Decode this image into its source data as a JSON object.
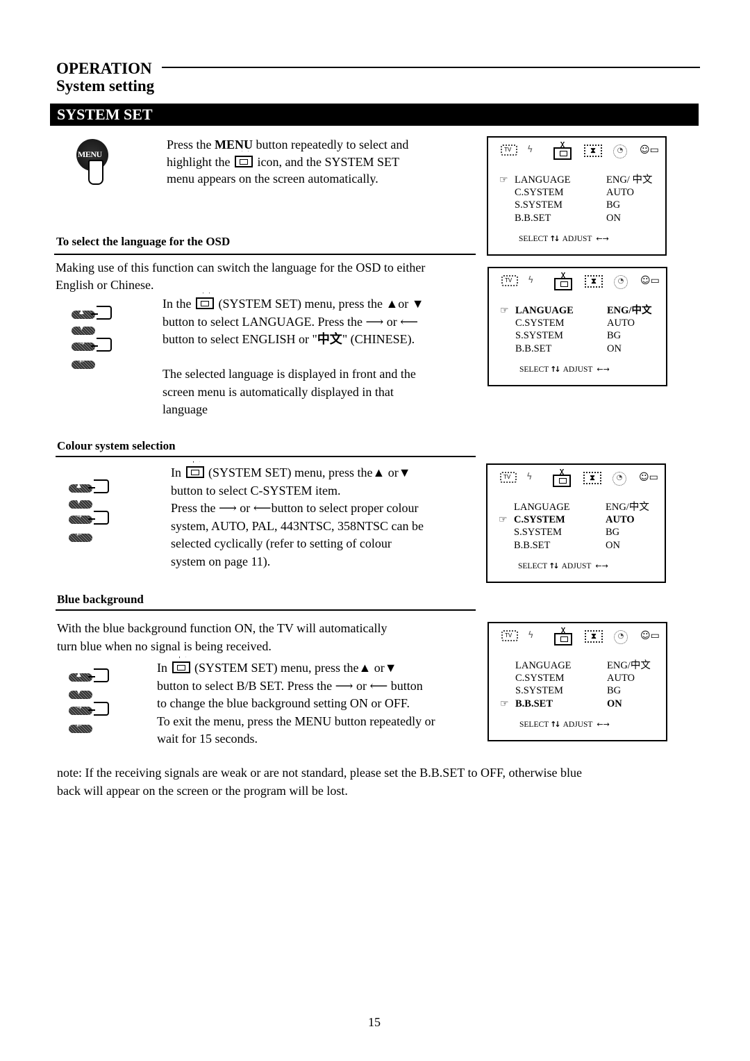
{
  "header": {
    "section": "OPERATION",
    "subtitle": "System setting",
    "banner": "SYSTEM SET"
  },
  "intro": {
    "menu_button_label": "MENU",
    "line1_pre": "Press the ",
    "line1_bold": "MENU",
    "line1_post": " button repeatedly to select and",
    "line2_pre": "highlight the",
    "line2_post": "icon, and the SYSTEM SET",
    "line3": "menu appears on the screen automatically."
  },
  "sections": {
    "language": {
      "title": "To select the language for the OSD",
      "desc1": "Making use of this function can switch the language for the OSD to either",
      "desc2": "English or Chinese.",
      "step1_pre": "In the",
      "step1_post": "(SYSTEM SET) menu, press the ▲or ▼",
      "step2": "button to select LANGUAGE. Press the ⟶ or ⟵",
      "step3_pre": "button to select ENGLISH or \"",
      "step3_cjk": "中文",
      "step3_post": "\" (CHINESE).",
      "note1": "The selected language is displayed in front and the",
      "note2": "screen menu is automatically displayed in that",
      "note3": "language"
    },
    "colour": {
      "title": "Colour system selection",
      "l1_pre": "In",
      "l1_post": "(SYSTEM SET) menu, press the▲ or▼",
      "l2": "button to select C-SYSTEM item.",
      "l3": "Press the ⟶ or ⟵button to select proper colour",
      "l4": "system, AUTO, PAL, 443NTSC, 358NTSC can be",
      "l5": "selected cyclically (refer to setting of colour",
      "l6": "system on page 11)."
    },
    "blue": {
      "title": "Blue background",
      "desc1": "With the blue background function ON, the TV will automatically",
      "desc2": "turn blue when no signal is being received.",
      "l1_pre": "In",
      "l1_post": "(SYSTEM SET) menu, press the▲ or▼",
      "l2": " button to select B/B SET. Press the ⟶ or ⟵ button",
      "l3": "to change the blue background setting ON or OFF.",
      "l4": "To exit the menu, press the MENU button repeatedly or",
      "l5": "wait for 15 seconds."
    }
  },
  "note": {
    "line1": "note: If the receiving signals are weak or are not standard, please set the B.B.SET to OFF, otherwise blue",
    "line2": "back will appear on the screen or the program will be lost."
  },
  "osd_icons": [
    "tv-icon",
    "antenna-icon",
    "system-set-icon",
    "hourglass-icon",
    "clock-icon",
    "person-talk-icon"
  ],
  "osd_screens": [
    {
      "selected": 0,
      "bold_selected": false,
      "rows": [
        {
          "label": "LANGUAGE",
          "value": "ENG/ 中文"
        },
        {
          "label": "C.SYSTEM",
          "value": "AUTO"
        },
        {
          "label": "S.SYSTEM",
          "value": "BG"
        },
        {
          "label": "B.B.SET",
          "value": "ON"
        }
      ],
      "footer_select": "SELECT",
      "footer_adjust": "ADJUST"
    },
    {
      "selected": 0,
      "bold_selected": true,
      "rows": [
        {
          "label": "LANGUAGE",
          "value": "ENG/中文"
        },
        {
          "label": "C.SYSTEM",
          "value": "AUTO"
        },
        {
          "label": "S.SYSTEM",
          "value": "BG"
        },
        {
          "label": "B.B.SET",
          "value": "ON"
        }
      ],
      "footer_select": "SELECT",
      "footer_adjust": "ADJUST"
    },
    {
      "selected": 1,
      "bold_selected": true,
      "rows": [
        {
          "label": "LANGUAGE",
          "value": "ENG/中文"
        },
        {
          "label": "C.SYSTEM",
          "value": "AUTO"
        },
        {
          "label": "S.SYSTEM",
          "value": "BG"
        },
        {
          "label": "B.B.SET",
          "value": "ON"
        }
      ],
      "footer_select": "SELECT",
      "footer_adjust": "ADJUST"
    },
    {
      "selected": 3,
      "bold_selected": true,
      "rows": [
        {
          "label": "LANGUAGE",
          "value": "ENG/中文"
        },
        {
          "label": "C.SYSTEM",
          "value": "AUTO"
        },
        {
          "label": "S.SYSTEM",
          "value": "BG"
        },
        {
          "label": "B.B.SET",
          "value": "ON"
        }
      ],
      "footer_select": "SELECT",
      "footer_adjust": "ADJUST"
    }
  ],
  "page_number": "15"
}
